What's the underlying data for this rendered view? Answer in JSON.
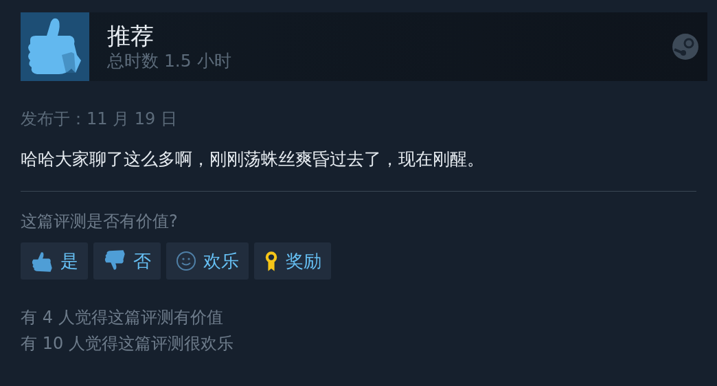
{
  "header": {
    "title": "推荐",
    "playtime": "总时数 1.5 小时"
  },
  "posted": "发布于：11 月 19 日",
  "review": "哈哈大家聊了这么多啊，刚刚荡蛛丝爽昏过去了，现在刚醒。",
  "question": "这篇评测是否有价值?",
  "buttons": [
    {
      "kind": "up",
      "label": "是"
    },
    {
      "kind": "down",
      "label": "否"
    },
    {
      "kind": "smile",
      "label": "欢乐"
    },
    {
      "kind": "award",
      "label": "奖励"
    }
  ],
  "stats": [
    "有 4 人觉得这篇评测有价值",
    "有 10 人觉得这篇评测很欢乐"
  ]
}
